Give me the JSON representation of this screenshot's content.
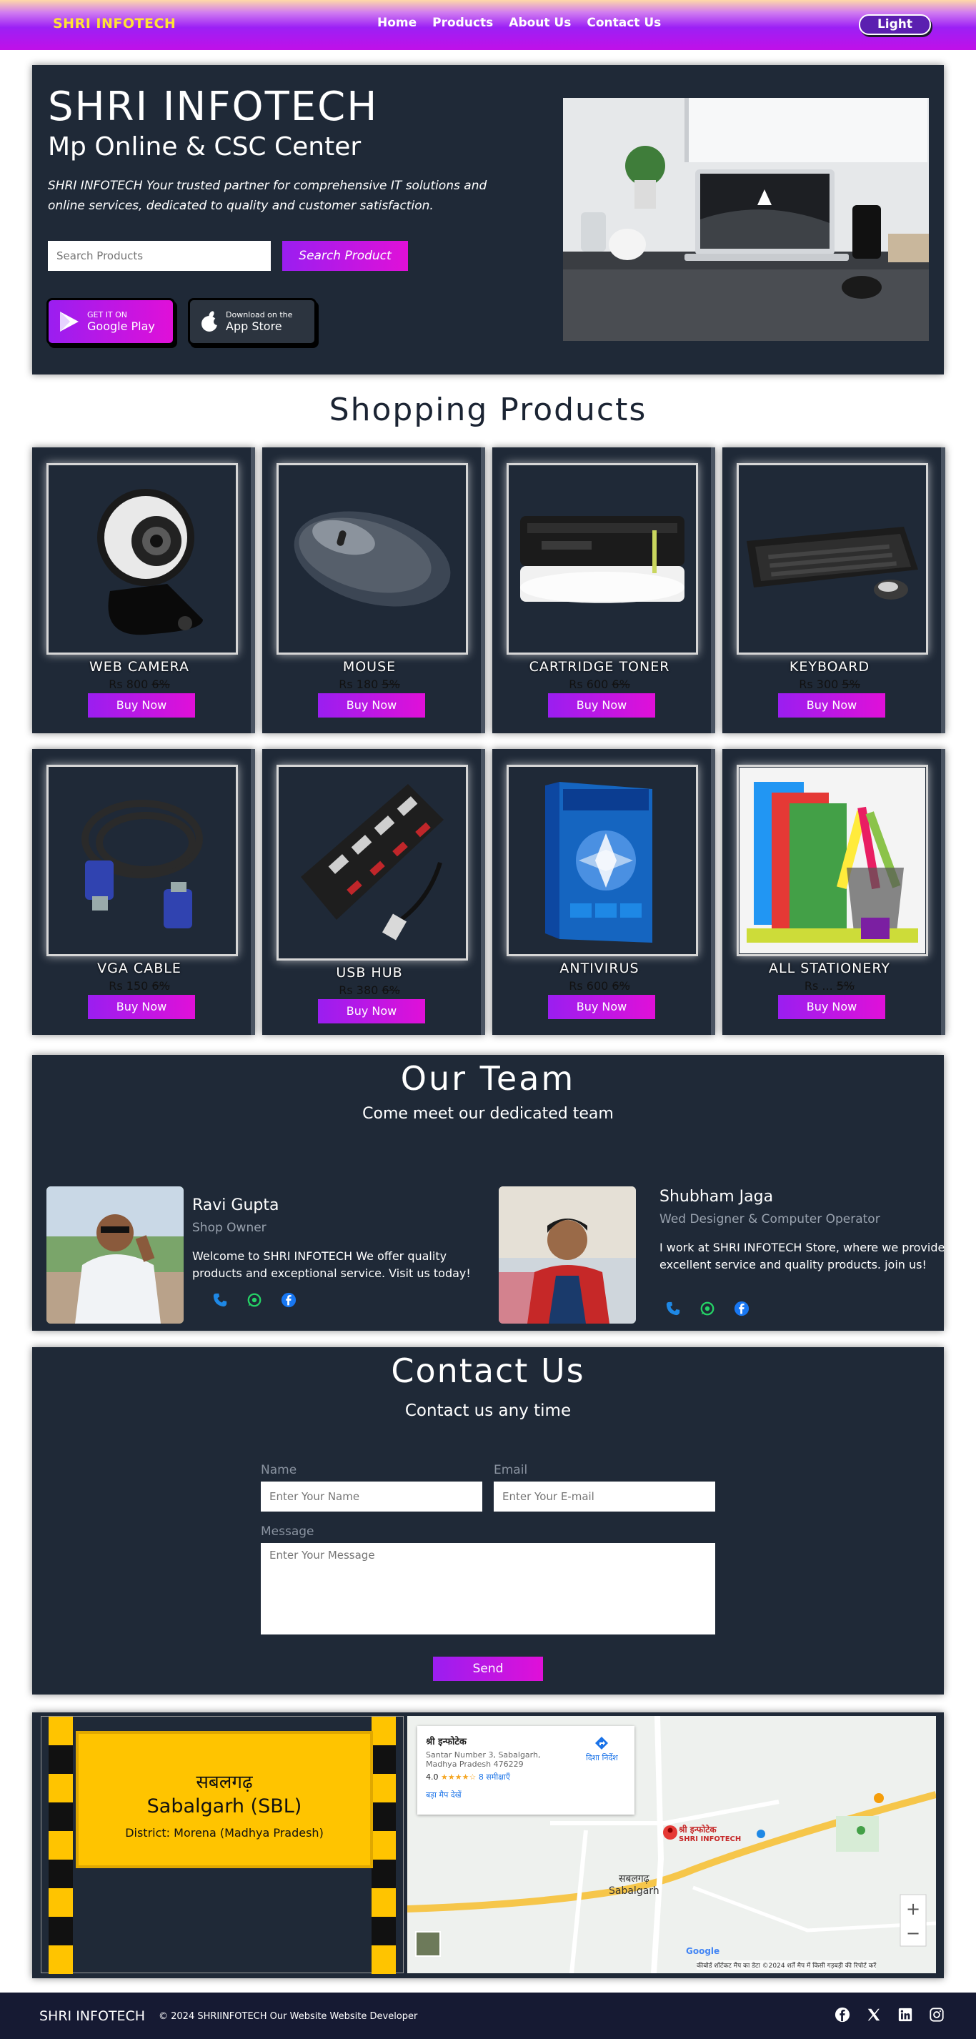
{
  "navbar": {
    "brand": "SHRI INFOTECH",
    "links": [
      "Home",
      "Products",
      "About Us",
      "Contact Us"
    ],
    "theme_toggle": "Light"
  },
  "hero": {
    "title": "SHRI INFOTECH",
    "subtitle": "Mp Online & CSC Center",
    "description": "SHRI INFOTECH Your trusted partner for comprehensive IT solutions and online services, dedicated to quality and customer satisfaction.",
    "search_placeholder": "Search Products",
    "search_button": "Search Product",
    "google_play_small": "GET IT ON",
    "google_play_big": "Google Play",
    "app_store_small": "Download on the",
    "app_store_big": "App Store"
  },
  "products_section": {
    "title": "Shopping Products",
    "buy_label": "Buy Now",
    "items": [
      {
        "name": "WEB CAMERA",
        "price": "Rs 800",
        "discount": "6%"
      },
      {
        "name": "MOUSE",
        "price": "Rs 180",
        "discount": "5%"
      },
      {
        "name": "CARTRIDGE TONER",
        "price": "Rs 600",
        "discount": "6%"
      },
      {
        "name": "KEYBOARD",
        "price": "Rs 300",
        "discount": "5%"
      },
      {
        "name": "VGA CABLE",
        "price": "Rs 150",
        "discount": "6%"
      },
      {
        "name": "USB HUB",
        "price": "Rs 380",
        "discount": "6%"
      },
      {
        "name": "ANTIVIRUS",
        "price": "Rs 600",
        "discount": "6%"
      },
      {
        "name": "ALL STATIONERY",
        "price": "Rs ...",
        "discount": "5%"
      }
    ]
  },
  "team": {
    "title": "Our Team",
    "subtitle": "Come meet our dedicated team",
    "members": [
      {
        "name": "Ravi Gupta",
        "role": "Shop Owner",
        "desc": "Welcome to SHRI INFOTECH We offer quality products and exceptional service. Visit us today!"
      },
      {
        "name": "Shubham Jaga",
        "role": "Wed Designer & Computer Operator",
        "desc": "I work at SHRI INFOTECH Store, where we provide excellent service and quality products. join us!"
      }
    ]
  },
  "contact": {
    "title": "Contact Us",
    "subtitle": "Contact us any time",
    "name_label": "Name",
    "name_placeholder": "Enter Your Name",
    "email_label": "Email",
    "email_placeholder": "Enter Your E-mail",
    "message_label": "Message",
    "message_placeholder": "Enter Your Message",
    "send": "Send"
  },
  "location": {
    "sign_hindi": "सबलगढ़",
    "sign_english": "Sabalgarh (SBL)",
    "sign_district": "District: Morena (Madhya Pradesh)",
    "map_place": "श्री इन्फोटेक",
    "map_address": "Santar Number 3, Sabalgarh, Madhya Pradesh 476229",
    "map_rating": "4.0",
    "map_reviews": "8 समीक्षाएँ",
    "map_directions": "दिशा निर्देश",
    "map_larger": "बड़ा मैप देखें",
    "map_pin": "श्री इन्फोटेक",
    "map_pin_sub": "SHRI INFOTECH",
    "map_town_hi": "सबलगढ़",
    "map_town": "Sabalgarh",
    "map_footer": "कीबोर्ड शॉर्टकट   मैप का डेटा ©2024   शर्तें   मैप में किसी गड़बड़ी की रिपोर्ट करें"
  },
  "footer": {
    "brand": "SHRI INFOTECH",
    "copyright": "© 2024 SHRIINFOTECH  Our Website  Website Developer"
  },
  "colors": {
    "panel": "#1f2937",
    "accent_gradient_start": "#9a1ef0",
    "accent_gradient_end": "#e010d8",
    "brand_yellow": "#ffe236",
    "footer_bg": "#161a33"
  }
}
